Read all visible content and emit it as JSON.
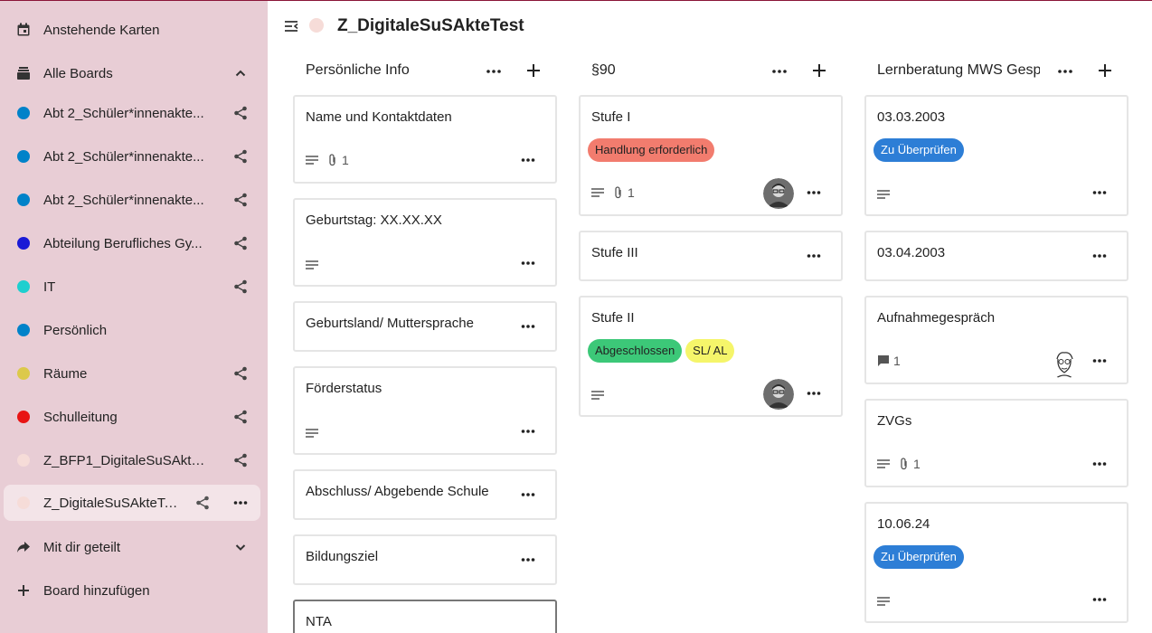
{
  "sidebar": {
    "items": [
      {
        "label": "Anstehende Karten",
        "icon": "calendar-icon"
      },
      {
        "label": "Alle Boards",
        "icon": "archive-icon",
        "trailing": "chevron-up-icon"
      },
      {
        "label": "Abt 2_Schüler*innenakte...",
        "color": "#0082c9",
        "trailing": "share-icon"
      },
      {
        "label": "Abt 2_Schüler*innenakte...",
        "color": "#0082c9",
        "trailing": "share-icon"
      },
      {
        "label": "Abt 2_Schüler*innenakte...",
        "color": "#0082c9",
        "trailing": "share-icon"
      },
      {
        "label": "Abteilung Berufliches Gy...",
        "color": "#1a1ad6",
        "trailing": "share-icon"
      },
      {
        "label": "IT",
        "color": "#1ecfcf",
        "trailing": "share-icon"
      },
      {
        "label": "Persönlich",
        "color": "#0082c9"
      },
      {
        "label": "Räume",
        "color": "#dcc94a",
        "trailing": "share-icon"
      },
      {
        "label": "Schulleitung",
        "color": "#e81414",
        "trailing": "share-icon"
      },
      {
        "label": "Z_BFP1_DigitaleSuSAkte...",
        "color": "#f6dcd8",
        "trailing": "share-icon"
      },
      {
        "label": "Z_DigitaleSuSAkteTest",
        "color": "#f6dcd8",
        "trailing": "share-icon",
        "active": true
      },
      {
        "label": "Mit dir geteilt",
        "icon": "share-arrow-icon",
        "trailing": "chevron-down-icon"
      },
      {
        "label": "Board hinzufügen",
        "icon": "plus-icon"
      }
    ]
  },
  "header": {
    "title": "Z_DigitaleSuSAkteTest",
    "board_color": "#f6dcd8"
  },
  "stacks": [
    {
      "title": "Persönliche Info",
      "cards": [
        {
          "title": "Name und Kontaktdaten",
          "attachments": "1"
        },
        {
          "title": "Geburtstag: XX.XX.XX"
        },
        {
          "title": "Geburtsland/ Muttersprache"
        },
        {
          "title": "Förderstatus"
        },
        {
          "title": "Abschluss/ Abgebende Schule"
        },
        {
          "title": "Bildungsziel"
        },
        {
          "title": "NTA"
        }
      ]
    },
    {
      "title": "§90",
      "cards": [
        {
          "title": "Stufe I",
          "labels": [
            {
              "text": "Handlung erforderlich",
              "color": "#f27c6e"
            }
          ],
          "attachments": "1"
        },
        {
          "title": "Stufe III"
        },
        {
          "title": "Stufe II",
          "labels": [
            {
              "text": "Abgeschlossen",
              "color": "#3cc878"
            },
            {
              "text": "SL/ AL",
              "color": "#f5f56a"
            }
          ]
        }
      ]
    },
    {
      "title": "Lernberatung MWS Gespräche",
      "cards": [
        {
          "title": "03.03.2003",
          "labels": [
            {
              "text": "Zu Überprüfen",
              "color": "#2d7ed6"
            }
          ]
        },
        {
          "title": "03.04.2003"
        },
        {
          "title": "Aufnahmegespräch",
          "comments": "1"
        },
        {
          "title": "ZVGs",
          "attachments": "1"
        },
        {
          "title": "10.06.24",
          "labels": [
            {
              "text": "Zu Überprüfen",
              "color": "#2d7ed6"
            }
          ]
        }
      ]
    }
  ]
}
